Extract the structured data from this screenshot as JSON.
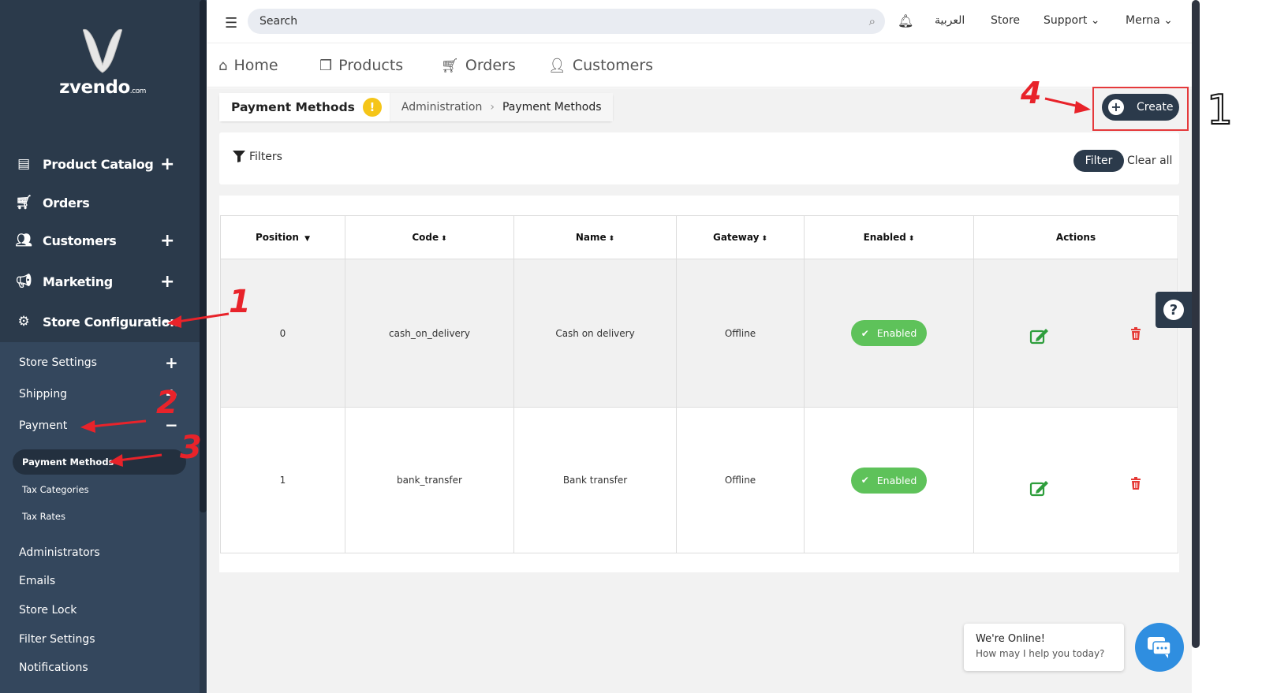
{
  "brand": {
    "name": "zvendo",
    "suffix": ".com"
  },
  "sidebar": {
    "main_items": [
      {
        "label": "Product Catalog",
        "icon": "boxes-icon",
        "has_plus": true
      },
      {
        "label": "Orders",
        "icon": "cart-icon",
        "has_plus": false
      },
      {
        "label": "Customers",
        "icon": "users-icon",
        "has_plus": true
      },
      {
        "label": "Marketing",
        "icon": "megaphone-icon",
        "has_plus": true
      },
      {
        "label": "Store Configuration",
        "icon": "gears-icon",
        "expanded": true
      }
    ],
    "sub_items": [
      {
        "label": "Store Settings",
        "toggle": "+"
      },
      {
        "label": "Shipping",
        "toggle": "+"
      },
      {
        "label": "Payment",
        "toggle": "−"
      }
    ],
    "payment_children": [
      {
        "label": "Payment Methods",
        "active": true
      },
      {
        "label": "Tax Categories"
      },
      {
        "label": "Tax Rates"
      }
    ],
    "more_items": [
      "Administrators",
      "Emails",
      "Store Lock",
      "Filter Settings",
      "Notifications"
    ]
  },
  "topbar": {
    "search_placeholder": "Search",
    "language": "العربية",
    "store": "Store",
    "support": "Support",
    "user": "Merna"
  },
  "subnav": [
    "Home",
    "Products",
    "Orders",
    "Customers"
  ],
  "breadcrumb": {
    "title": "Payment Methods",
    "path": [
      "Administration",
      "Payment Methods"
    ]
  },
  "create_label": "Create",
  "filters": {
    "label": "Filters",
    "filter_button": "Filter",
    "clear_all": "Clear all"
  },
  "table": {
    "columns": [
      "Position",
      "Code",
      "Name",
      "Gateway",
      "Enabled",
      "Actions"
    ],
    "rows": [
      {
        "position": "0",
        "code": "cash_on_delivery",
        "name": "Cash on delivery",
        "gateway": "Offline",
        "enabled": "Enabled"
      },
      {
        "position": "1",
        "code": "bank_transfer",
        "name": "Bank transfer",
        "gateway": "Offline",
        "enabled": "Enabled"
      }
    ]
  },
  "chat": {
    "title": "We're Online!",
    "subtitle": "How may I help you today?"
  },
  "annotations": [
    "1",
    "2",
    "3",
    "4",
    "1"
  ],
  "colors": {
    "sidebar": "#2b3a4b",
    "accent_dark": "#2b3a4b",
    "enabled_green": "#5ec25a",
    "delete_red": "#e53935",
    "annotation_red": "#e8232a"
  }
}
